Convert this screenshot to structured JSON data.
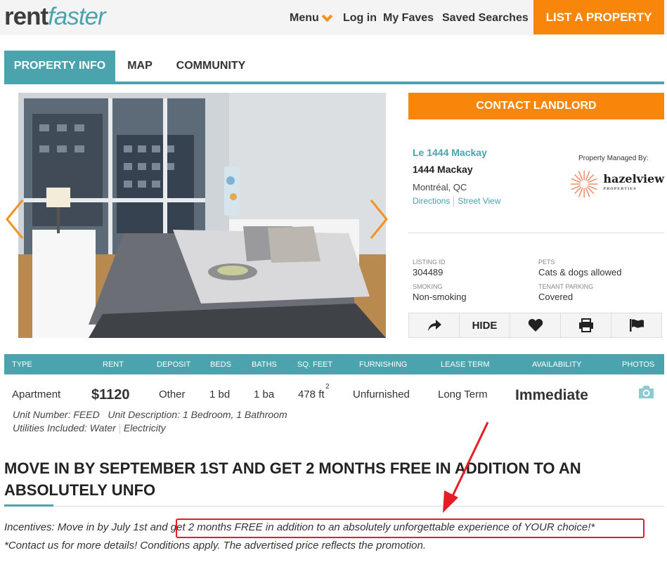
{
  "header": {
    "logo_rent": "rent",
    "logo_faster": "faster",
    "nav": [
      "Menu",
      "Log in",
      "My Faves",
      "Saved Searches"
    ],
    "list_property": "LIST A PROPERTY"
  },
  "tabs": [
    {
      "label": "PROPERTY INFO",
      "active": true
    },
    {
      "label": "MAP",
      "active": false
    },
    {
      "label": "COMMUNITY",
      "active": false
    }
  ],
  "contact_button": "CONTACT LANDLORD",
  "property": {
    "name": "Le 1444 Mackay",
    "address": "1444 Mackay",
    "city": "Montréal, QC",
    "links": [
      "Directions",
      "Street View"
    ],
    "managed_by_label": "Property Managed By:",
    "manager_logo_text": "hazelview",
    "manager_logo_sub": "PROPERTIES"
  },
  "meta": {
    "listing_id_label": "LISTING ID",
    "listing_id": "304489",
    "pets_label": "PETS",
    "pets": "Cats & dogs allowed",
    "smoking_label": "SMOKING",
    "smoking": "Non-smoking",
    "parking_label": "TENANT PARKING",
    "parking": "Covered"
  },
  "actions": {
    "share_icon": "share-icon",
    "hide": "HIDE",
    "fave_icon": "heart-icon",
    "print_icon": "print-icon",
    "report_icon": "flag-icon"
  },
  "summary": {
    "headers": [
      "TYPE",
      "RENT",
      "DEPOSIT",
      "BEDS",
      "BATHS",
      "SQ. FEET",
      "FURNISHING",
      "LEASE TERM",
      "AVAILABILITY",
      "PHOTOS"
    ],
    "values": {
      "type": "Apartment",
      "rent": "$1120",
      "deposit": "Other",
      "beds": "1 bd",
      "baths": "1 ba",
      "sqft": "478 ft",
      "sqft_sup": "2",
      "furnishing": "Unfurnished",
      "lease": "Long Term",
      "availability": "Immediate"
    },
    "unit_number": "Unit Number: FEED",
    "unit_description": "Unit Description: 1 Bedroom, 1 Bathroom",
    "utilities": "Utilities Included: Water",
    "utilities_extra": "Electricity"
  },
  "headline": "MOVE IN BY SEPTEMBER 1ST AND GET 2 MONTHS FREE IN ADDITION TO AN ABSOLUTELY UNFO",
  "incentives": {
    "line1_pre": "Incentives: Move in by July 1st and ",
    "line1_highlight": "get 2 months FREE in addition to an absolutely unforgettable experience of YOUR choice!*",
    "line2": "*Contact us for more details! Conditions apply. The advertised price reflects the promotion."
  },
  "colors": {
    "teal": "#4aa3ad",
    "orange": "#f7860b",
    "annotation_red": "#e51e25"
  }
}
